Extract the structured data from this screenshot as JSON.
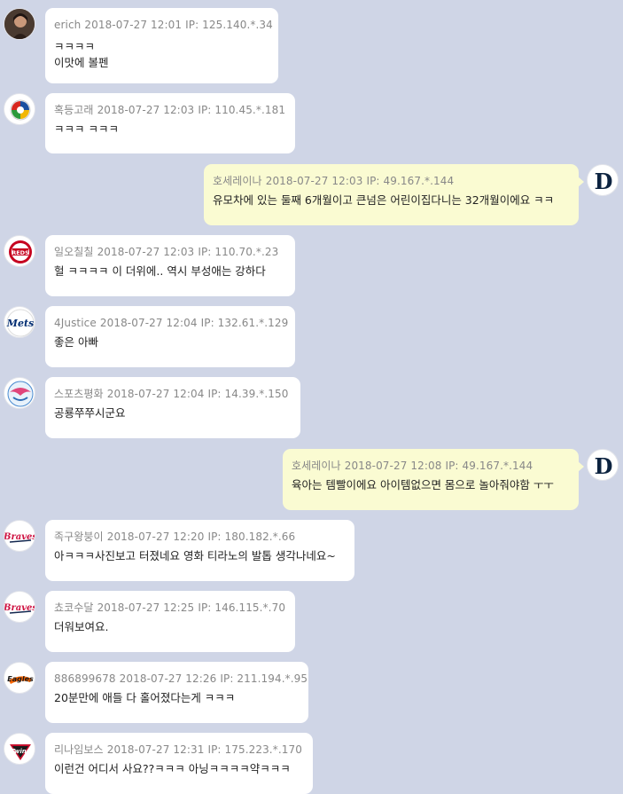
{
  "messages": [
    {
      "nick": "erich",
      "date": "2018-07-27 12:01",
      "ip": "IP: 125.140.*.34",
      "lines": [
        "ㅋㅋㅋㅋ",
        "이맛에 볼펜"
      ],
      "side": "left",
      "avatar": "user-photo"
    },
    {
      "nick": "혹등고래",
      "date": "2018-07-27 12:03",
      "ip": "IP: 110.45.*.181",
      "lines": [
        "ㅋㅋㅋ ㅋㅋㅋ"
      ],
      "side": "left",
      "avatar": "wbc-logo"
    },
    {
      "nick": "호세레이나",
      "date": "2018-07-27 12:03",
      "ip": "IP: 49.167.*.144",
      "lines": [
        "유모차에 있는 둘째 6개월이고 큰넘은 어린이집다니는 32개월이에요 ㅋㅋ"
      ],
      "side": "right",
      "avatar": "tigers-d-logo"
    },
    {
      "nick": "일오칠칠",
      "date": "2018-07-27 12:03",
      "ip": "IP: 110.70.*.23",
      "lines": [
        "헐 ㅋㅋㅋㅋ 이 더위에.. 역시 부성애는 강하다"
      ],
      "side": "left",
      "avatar": "reds-logo"
    },
    {
      "nick": "4Justice",
      "date": "2018-07-27 12:04",
      "ip": "IP: 132.61.*.129",
      "lines": [
        "좋은 아빠"
      ],
      "side": "left",
      "avatar": "mets-logo"
    },
    {
      "nick": "스포츠평화",
      "date": "2018-07-27 12:04",
      "ip": "IP: 14.39.*.150",
      "lines": [
        "공룡쭈쭈시군요"
      ],
      "side": "left",
      "avatar": "eagle-logo"
    },
    {
      "nick": "호세레이나",
      "date": "2018-07-27 12:08",
      "ip": "IP: 49.167.*.144",
      "lines": [
        "육아는 템빨이에요 아이템없으면 몸으로 놀아줘야함 ㅜㅜ"
      ],
      "side": "right",
      "avatar": "tigers-d-logo"
    },
    {
      "nick": "족구왕붕이",
      "date": "2018-07-27 12:20",
      "ip": "IP: 180.182.*.66",
      "lines": [
        "아ㅋㅋㅋ사진보고 터졌네요 영화 티라노의 발톱 생각나네요~"
      ],
      "side": "left",
      "avatar": "braves-logo"
    },
    {
      "nick": "쵸코수달",
      "date": "2018-07-27 12:25",
      "ip": "IP: 146.115.*.70",
      "lines": [
        "더워보여요."
      ],
      "side": "left",
      "avatar": "braves-logo"
    },
    {
      "nick": "886899678",
      "date": "2018-07-27 12:26",
      "ip": "IP: 211.194.*.95",
      "lines": [
        "20분만에 애들 다 홀어졌다는게 ㅋㅋㅋ"
      ],
      "side": "left",
      "avatar": "eagles-logo"
    },
    {
      "nick": "리나임보스",
      "date": "2018-07-27 12:31",
      "ip": "IP: 175.223.*.170",
      "lines": [
        "이런건 어디서 사요??ㅋㅋㅋ 아닝ㅋㅋㅋㅋ약ㅋㅋㅋ"
      ],
      "side": "left",
      "avatar": "twins-logo"
    }
  ],
  "colors": {
    "background": "#cfd5e6",
    "left_bubble": "#ffffff",
    "right_bubble": "#fafbd2",
    "meta": "#888888"
  }
}
